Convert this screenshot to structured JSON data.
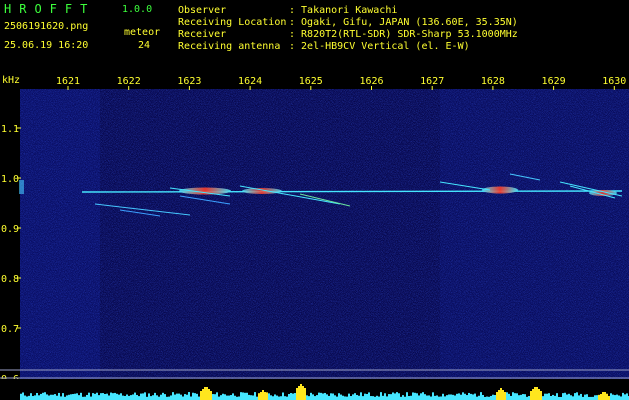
{
  "app": {
    "name": "HROFFT",
    "version": "1.0.0"
  },
  "file": {
    "name": "2506191620.png",
    "timestamp": "25.06.19 16:20"
  },
  "counter": {
    "label": "meteor",
    "value": "24"
  },
  "station": {
    "rows": [
      {
        "label": "Observer",
        "value": ": Takanori Kawachi"
      },
      {
        "label": "Receiving Location",
        "value": ": Ogaki, Gifu, JAPAN (136.60E, 35.35N)"
      },
      {
        "label": "Receiver",
        "value": ": R820T2(RTL-SDR) SDR-Sharp 53.1000MHz"
      },
      {
        "label": "Receiving antenna",
        "value": ": 2el-HB9CV Vertical (el. E-W)"
      }
    ]
  },
  "axes": {
    "y_unit": "kHz",
    "y_ticks": [
      "1.1",
      "1.0",
      "0.9",
      "0.8",
      "0.7",
      "0.6"
    ],
    "x_ticks": [
      "1621",
      "1622",
      "1623",
      "1624",
      "1625",
      "1626",
      "1627",
      "1628",
      "1629",
      "1630"
    ]
  },
  "colors": {
    "label_green": "#3cff3c",
    "label_yellow": "#ffff30",
    "background": "#0a0a6e",
    "carrier": "#46e6ff",
    "hot": "#ff3c28"
  }
}
